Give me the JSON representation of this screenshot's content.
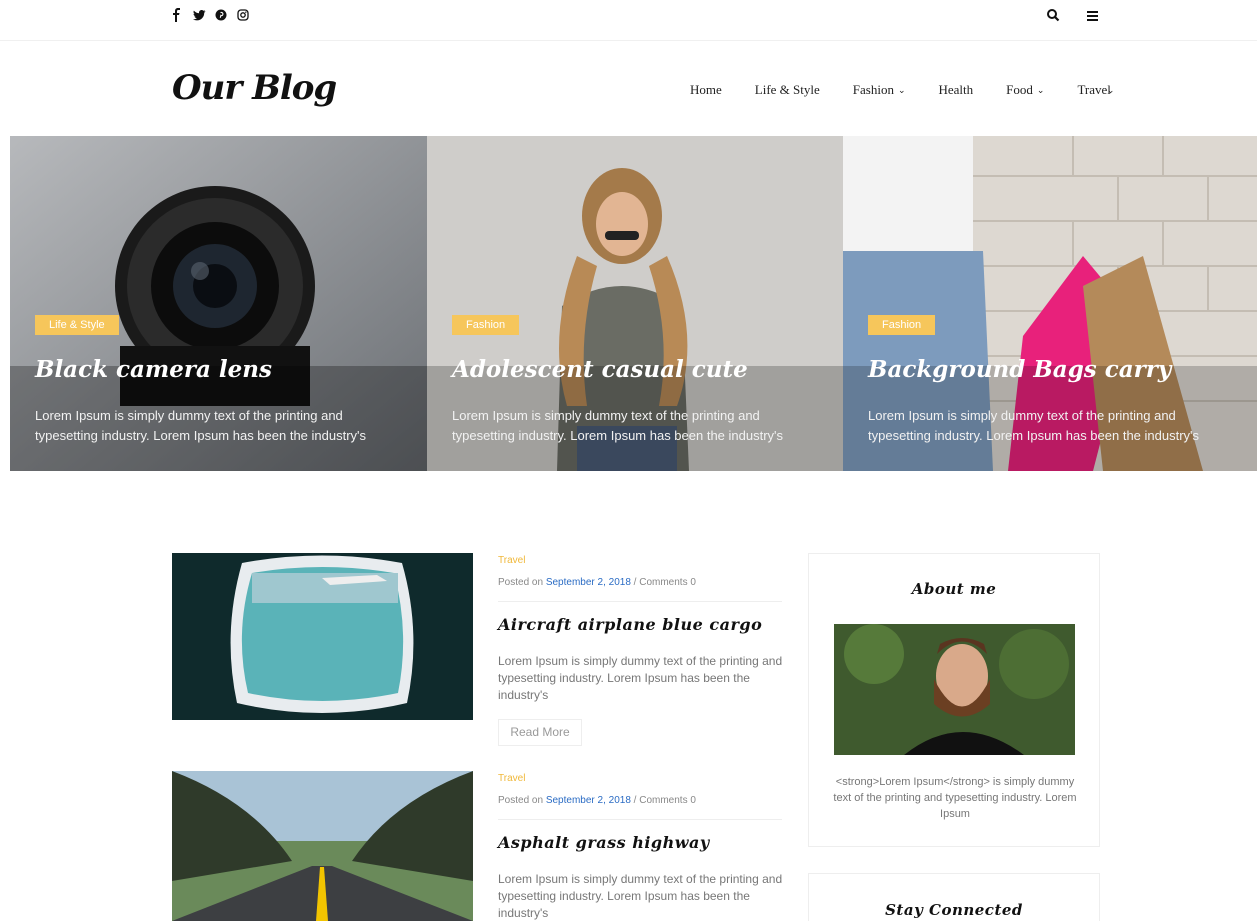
{
  "topbar": {
    "social": [
      {
        "name": "facebook-icon",
        "glyph": "f"
      },
      {
        "name": "twitter-icon",
        "glyph": "t"
      },
      {
        "name": "pinterest-icon",
        "glyph": "p"
      },
      {
        "name": "instagram-icon",
        "glyph": "o"
      }
    ],
    "right_icons": [
      "search-icon",
      "menu-icon"
    ]
  },
  "header": {
    "logo": "Our Blog",
    "nav": [
      {
        "label": "Home",
        "dropdown": false
      },
      {
        "label": "Life & Style",
        "dropdown": false
      },
      {
        "label": "Fashion",
        "dropdown": true
      },
      {
        "label": "Health",
        "dropdown": false
      },
      {
        "label": "Food",
        "dropdown": true
      },
      {
        "label": "Travel",
        "dropdown": true
      }
    ]
  },
  "hero": {
    "tag_color": "#f6c65b",
    "slides": [
      {
        "tag": "Life & Style",
        "title": "Black camera lens",
        "excerpt": "Lorem Ipsum is simply dummy text of the printing and typesetting industry. Lorem Ipsum has been the industry's"
      },
      {
        "tag": "Fashion",
        "title": "Adolescent casual cute",
        "excerpt": "Lorem Ipsum is simply dummy text of the printing and typesetting industry. Lorem Ipsum has been the industry's"
      },
      {
        "tag": "Fashion",
        "title": "Background Bags carry",
        "excerpt": "Lorem Ipsum is simply dummy text of the printing and typesetting industry. Lorem Ipsum has been the industry's"
      }
    ]
  },
  "posts": [
    {
      "category": "Travel",
      "posted_on": "Posted on",
      "date": "September 2, 2018",
      "comments": "/ Comments 0",
      "title": "Aircraft airplane blue cargo",
      "excerpt": "Lorem Ipsum is simply dummy text of the printing and typesetting industry. Lorem Ipsum has been the industry's",
      "read_more": "Read More"
    },
    {
      "category": "Travel",
      "posted_on": "Posted on",
      "date": "September 2, 2018",
      "comments": "/ Comments 0",
      "title": "Asphalt grass highway",
      "excerpt": "Lorem Ipsum is simply dummy text of the printing and typesetting industry. Lorem Ipsum has been the industry's"
    }
  ],
  "sidebar": {
    "about": {
      "title": "About me",
      "text": "<strong>Lorem Ipsum</strong> is simply dummy text of the printing and typesetting industry. Lorem Ipsum"
    },
    "stay_connected": {
      "title": "Stay Connected"
    }
  },
  "colors": {
    "accent": "#f6c65b",
    "category": "#f0b83a",
    "link": "#2b6cc4"
  }
}
